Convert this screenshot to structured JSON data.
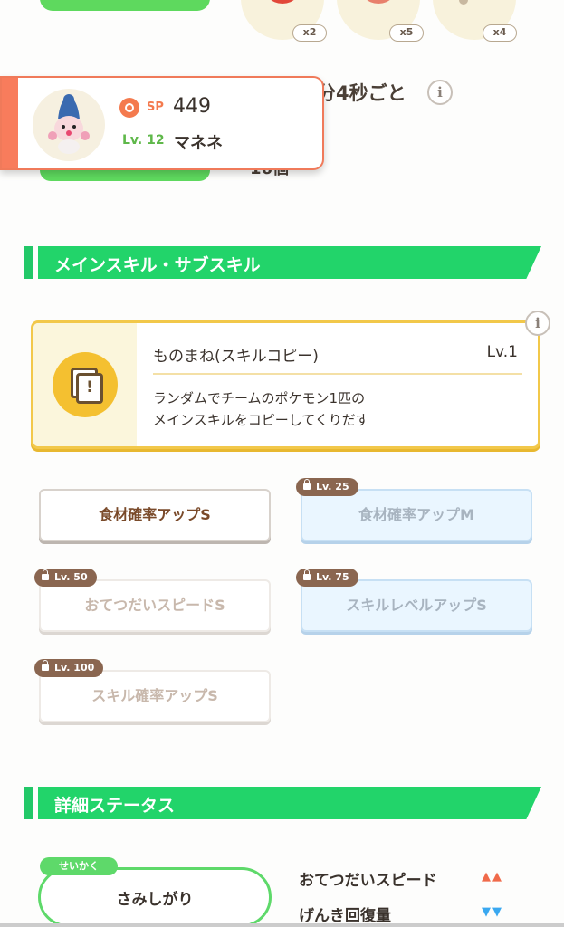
{
  "top": {
    "food_counts": [
      "x2",
      "x5",
      "x4"
    ],
    "help_interval_text": "分4秒ごと",
    "count_text": "16個"
  },
  "pokemon_card": {
    "sp_label": "SP",
    "sp_value": "449",
    "level": "Lv. 12",
    "name": "マネネ"
  },
  "main_sub_skill_section": {
    "title": "メインスキル・サブスキル",
    "main_skill": {
      "name": "ものまね(スキルコピー)",
      "level": "Lv.1",
      "description_line1": "ランダムでチームのポケモン1匹の",
      "description_line2": "メインスキルをコピーしてくりだす",
      "icon": "skill-copy-icon"
    },
    "sub_skills": [
      {
        "label": "食材確率アップS",
        "lock": ""
      },
      {
        "label": "食材確率アップM",
        "lock": "Lv. 25"
      },
      {
        "label": "おてつだいスピードS",
        "lock": "Lv. 50"
      },
      {
        "label": "スキルレベルアップS",
        "lock": "Lv. 75"
      },
      {
        "label": "スキル確率アップS",
        "lock": "Lv. 100"
      }
    ]
  },
  "detail_section": {
    "title": "詳細ステータス",
    "nature_tag": "せいかく",
    "nature_value": "さみしがり",
    "stat_up": "おてつだいスピード",
    "stat_up_arrows": "▲▲",
    "stat_down": "げんき回復量",
    "stat_down_arrows": "▼▼"
  },
  "colors": {
    "accent_green": "#22d46a",
    "card_orange": "#f87c5c",
    "skill_gold": "#f2c84a"
  }
}
